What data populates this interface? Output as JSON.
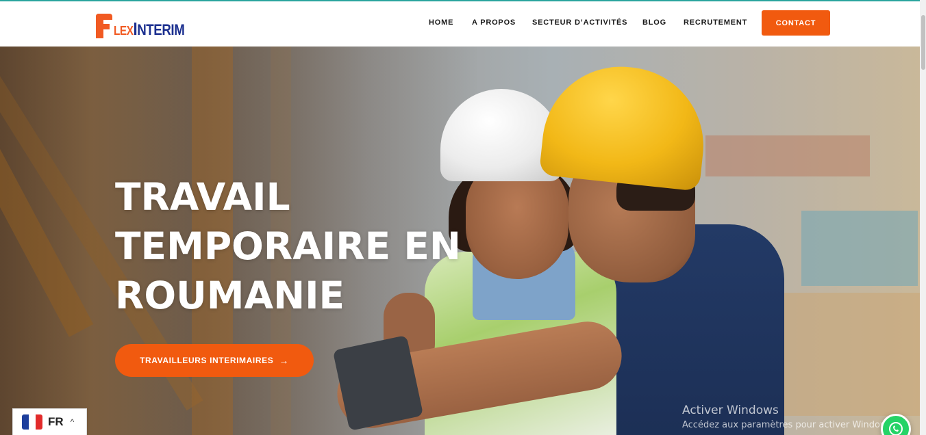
{
  "logo": {
    "f": "F",
    "lex": "LEX",
    "i": "I",
    "nterim": "NTERIM"
  },
  "nav": {
    "items": [
      {
        "label": "HOME"
      },
      {
        "label": "A PROPOS"
      },
      {
        "label": "SECTEUR D’ACTIVITÉS"
      },
      {
        "label": "BLOG"
      },
      {
        "label": "RECRUTEMENT"
      }
    ],
    "contact_label": "CONTACT"
  },
  "hero": {
    "title_lines": [
      "TRAVAIL",
      "TEMPORAIRE EN",
      "ROUMANIE"
    ],
    "cta_label": "TRAVAILLEURS INTERIMAIRES",
    "cta_arrow": "→"
  },
  "language": {
    "code": "FR",
    "chevron": "^"
  },
  "watermark": {
    "line1": "Activer Windows",
    "line2": "Accédez aux paramètres pour activer Windows."
  },
  "colors": {
    "accent": "#f15a0f",
    "brand_blue": "#1b2f8f",
    "whatsapp": "#25d366"
  }
}
